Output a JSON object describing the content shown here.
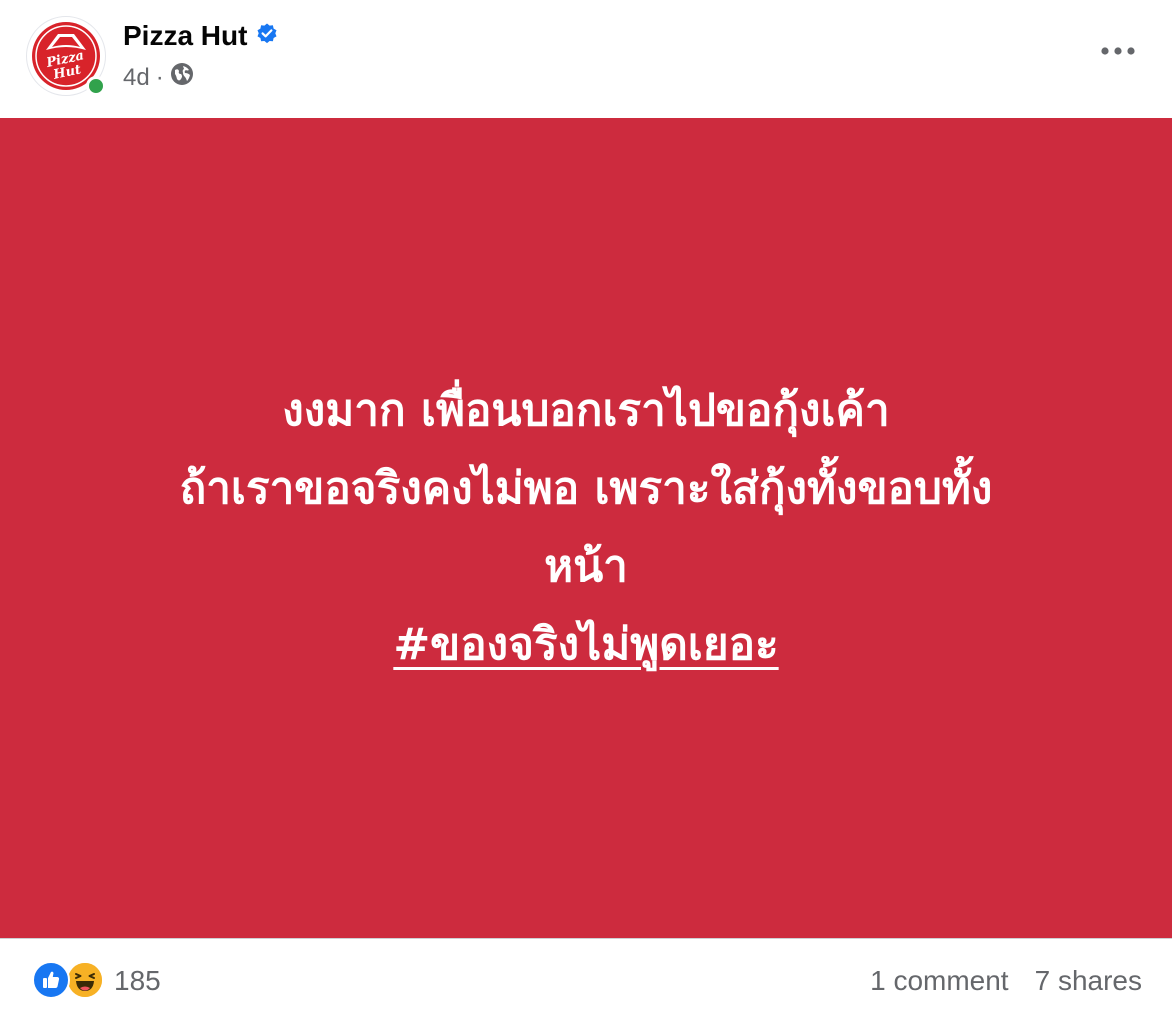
{
  "post": {
    "page_name": "Pizza Hut",
    "verified": true,
    "time_ago": "4d",
    "separator": "·",
    "audience_icon": "globe-icon",
    "more_icon": "more-horizontal-icon",
    "avatar_logo": "Pizza Hut",
    "content": {
      "lines": [
        "งงมาก เพื่อนบอกเราไปขอกุ้งเค้า",
        "ถ้าเราขอจริงคงไม่พอ เพราะใส่กุ้งทั้งขอบทั้ง",
        "หน้า"
      ],
      "hashtag": "#ของจริงไม่พูดเยอะ",
      "background_color": "#cd2b3e"
    },
    "reactions": {
      "icons": [
        "like-icon",
        "haha-icon"
      ],
      "count": "185"
    },
    "comments_label": "1 comment",
    "shares_label": "7 shares"
  },
  "colors": {
    "accent_blue": "#1877f2",
    "online_green": "#31a24c",
    "brand_red": "#cd2b3e",
    "secondary_text": "#65676b"
  }
}
